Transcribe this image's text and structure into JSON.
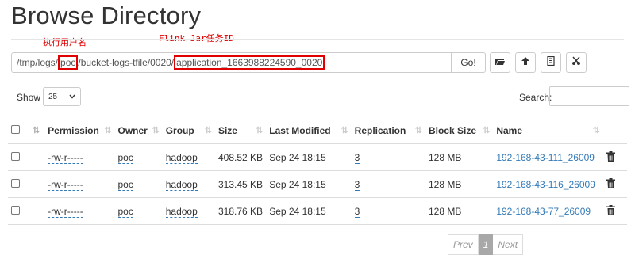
{
  "header": {
    "title": "Browse Directory"
  },
  "annotations": {
    "user": "执行用户名",
    "jobid": "Flink Jar任务ID"
  },
  "path": {
    "prefix": "/tmp/logs/",
    "user": "poc",
    "middle": "/bucket-logs-tfile/0020/",
    "application": "application_1663988224590_0020",
    "go_label": "Go!"
  },
  "toolbar": {
    "icons": [
      "folder-open-icon",
      "upload-icon",
      "list-icon",
      "cut-icon"
    ]
  },
  "controls": {
    "show_label": "Show",
    "page_size": "25",
    "search_label": "Search:"
  },
  "table": {
    "columns": [
      "Permission",
      "Owner",
      "Group",
      "Size",
      "Last Modified",
      "Replication",
      "Block Size",
      "Name"
    ],
    "rows": [
      {
        "permission": "-rw-r-----",
        "owner": "poc",
        "group": "hadoop",
        "size": "408.52 KB",
        "modified": "Sep 24 18:15",
        "replication": "3",
        "block": "128 MB",
        "name": "192-168-43-111_26009"
      },
      {
        "permission": "-rw-r-----",
        "owner": "poc",
        "group": "hadoop",
        "size": "313.45 KB",
        "modified": "Sep 24 18:15",
        "replication": "3",
        "block": "128 MB",
        "name": "192-168-43-116_26009"
      },
      {
        "permission": "-rw-r-----",
        "owner": "poc",
        "group": "hadoop",
        "size": "318.76 KB",
        "modified": "Sep 24 18:15",
        "replication": "3",
        "block": "128 MB",
        "name": "192-168-43-77_26009"
      }
    ]
  },
  "pagination": {
    "prev": "Prev",
    "current": "1",
    "next": "Next"
  },
  "colors": {
    "link": "#337ab7",
    "annotation": "#e00000"
  }
}
